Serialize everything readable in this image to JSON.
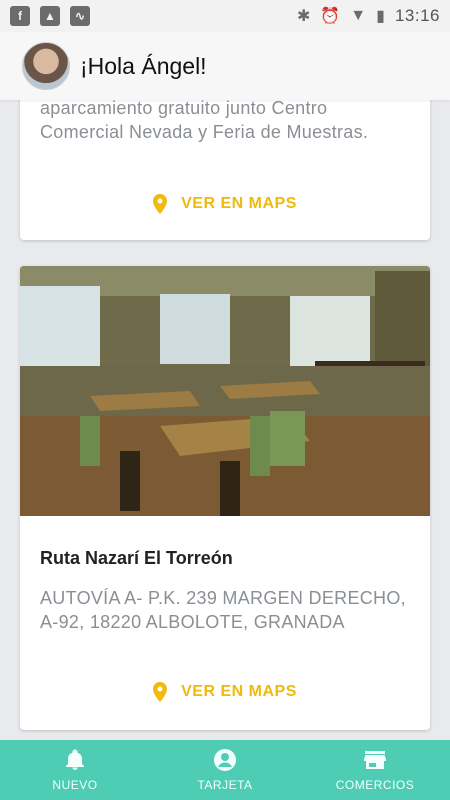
{
  "status_bar": {
    "time": "13:16",
    "left_icons": [
      "facebook-icon",
      "image-icon",
      "activity-icon"
    ],
    "right_icons": [
      "bluetooth-icon",
      "alarm-icon",
      "wifi-icon",
      "battery-icon"
    ]
  },
  "header": {
    "greeting": "¡Hola Ángel!"
  },
  "cards": [
    {
      "address": "aparcamiento gratuito junto Centro Comercial Nevada y Feria de Muestras.",
      "maps_label": "VER EN MAPS"
    },
    {
      "title": "Ruta Nazarí El Torreón",
      "address": "AUTOVÍA A- P.K. 239 MARGEN DERECHO, A-92, 18220 ALBOLOTE, GRANADA",
      "maps_label": "VER EN MAPS"
    }
  ],
  "bottom_nav": [
    {
      "label": "NUEVO",
      "icon": "bell-icon"
    },
    {
      "label": "TARJETA",
      "icon": "user-circle-icon"
    },
    {
      "label": "COMERCIOS",
      "icon": "store-icon"
    }
  ],
  "colors": {
    "accent": "#f0b90b",
    "nav_background": "#4ecdb4",
    "text_muted": "#8a8f95"
  }
}
